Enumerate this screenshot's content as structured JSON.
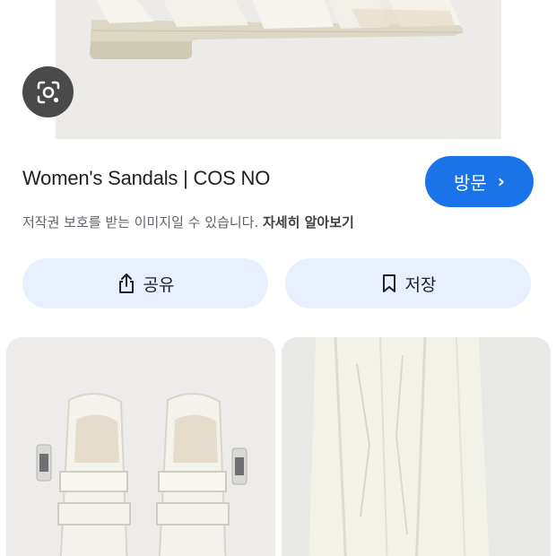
{
  "result": {
    "title": "Women's Sandals | COS NO",
    "visit_label": "방문",
    "visit_chevron": "›",
    "copyright_notice": "저작권 보호를 받는 이미지일 수 있습니다.",
    "learn_more_label": "자세히 알아보기"
  },
  "actions": {
    "share_label": "공유",
    "save_label": "저장"
  },
  "icons": {
    "lens": "lens-search-icon",
    "share": "share-icon",
    "bookmark": "bookmark-icon",
    "chevron": "chevron-right-icon"
  },
  "colors": {
    "accent": "#1a73e8",
    "pill_bg": "#e8f0fe",
    "lens_bg": "#4a4a4a",
    "title_text": "#202124",
    "muted_text": "#5f6368"
  }
}
